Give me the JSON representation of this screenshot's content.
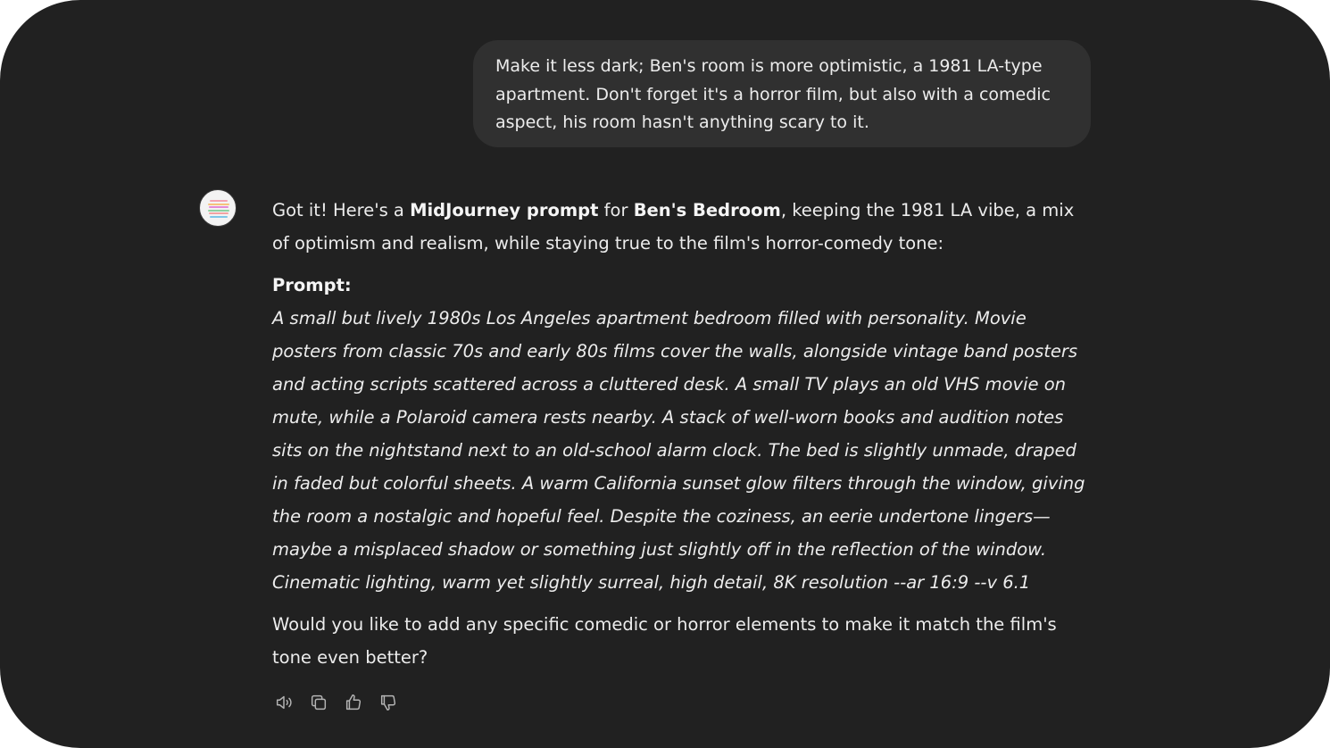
{
  "user_message": {
    "text": "Make it less dark; Ben's room is more optimistic, a 1981 LA-type apartment. Don't forget it's a horror film, but also with a comedic aspect, his room hasn't anything scary to it."
  },
  "assistant_message": {
    "avatar_icon": "assistant-avatar-icon",
    "intro_1": "Got it! Here's a ",
    "intro_bold_1": "MidJourney prompt",
    "intro_2": " for ",
    "intro_bold_2": "Ben's Bedroom",
    "intro_3": ", keeping the 1981 LA vibe, a mix of optimism and realism, while staying true to the film's horror-comedy tone:",
    "prompt_label": "Prompt:",
    "prompt_text": "A small but lively 1980s Los Angeles apartment bedroom filled with personality. Movie posters from classic 70s and early 80s films cover the walls, alongside vintage band posters and acting scripts scattered across a cluttered desk. A small TV plays an old VHS movie on mute, while a Polaroid camera rests nearby. A stack of well-worn books and audition notes sits on the nightstand next to an old-school alarm clock. The bed is slightly unmade, draped in faded but colorful sheets. A warm California sunset glow filters through the window, giving the room a nostalgic and hopeful feel. Despite the coziness, an eerie undertone lingers—maybe a misplaced shadow or something just slightly off in the reflection of the window. Cinematic lighting, warm yet slightly surreal, high detail, 8K resolution --ar 16:9 --v 6.1",
    "followup": "Would you like to add any specific comedic or horror elements to make it match the film's tone even better?"
  },
  "actions": [
    {
      "name": "read-aloud-button",
      "icon": "speaker-icon"
    },
    {
      "name": "copy-button",
      "icon": "copy-icon"
    },
    {
      "name": "good-response-button",
      "icon": "thumbs-up-icon"
    },
    {
      "name": "bad-response-button",
      "icon": "thumbs-down-icon"
    }
  ],
  "colors": {
    "background": "#212121",
    "user_bubble": "#303030",
    "text": "#ececec",
    "icon": "#b4b4b4"
  }
}
